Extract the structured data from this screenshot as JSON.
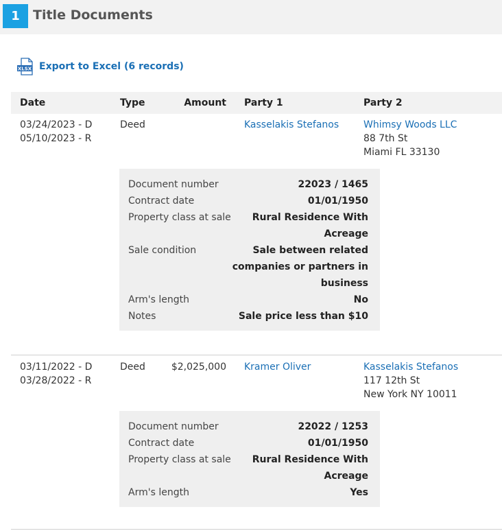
{
  "section": {
    "number": "1",
    "title": "Title Documents"
  },
  "export": {
    "label": "Export to Excel (6 records)",
    "icon_text": "XLSX"
  },
  "columns": {
    "date": "Date",
    "type": "Type",
    "amount": "Amount",
    "party1": "Party 1",
    "party2": "Party 2"
  },
  "records": [
    {
      "date_d": "03/24/2023 - D",
      "date_r": "05/10/2023 - R",
      "type": "Deed",
      "amount": "",
      "party1": "Kasselakis Stefanos",
      "party2_name": "Whimsy Woods LLC",
      "party2_addr1": "88 7th St",
      "party2_addr2": "Miami FL 33130",
      "details": {
        "doc_number_label": "Document number",
        "doc_number": "22023 / 1465",
        "contract_date_label": "Contract date",
        "contract_date": "01/01/1950",
        "property_class_label": "Property class at sale",
        "property_class_1": "Rural Residence With",
        "property_class_2": "Acreage",
        "sale_condition_label": "Sale condition",
        "sale_condition_1": "Sale between related",
        "sale_condition_2": "companies or partners in",
        "sale_condition_3": "business",
        "arms_length_label": "Arm's length",
        "arms_length": "No",
        "notes_label": "Notes",
        "notes": "Sale price less than $10"
      }
    },
    {
      "date_d": "03/11/2022 - D",
      "date_r": "03/28/2022 - R",
      "type": "Deed",
      "amount": "$2,025,000",
      "party1": "Kramer Oliver",
      "party2_name": "Kasselakis Stefanos",
      "party2_addr1": "117 12th St",
      "party2_addr2": "New York NY 10011",
      "details": {
        "doc_number_label": "Document number",
        "doc_number": "22022 / 1253",
        "contract_date_label": "Contract date",
        "contract_date": "01/01/1950",
        "property_class_label": "Property class at sale",
        "property_class_1": "Rural Residence With",
        "property_class_2": "Acreage",
        "arms_length_label": "Arm's length",
        "arms_length": "Yes"
      }
    }
  ]
}
